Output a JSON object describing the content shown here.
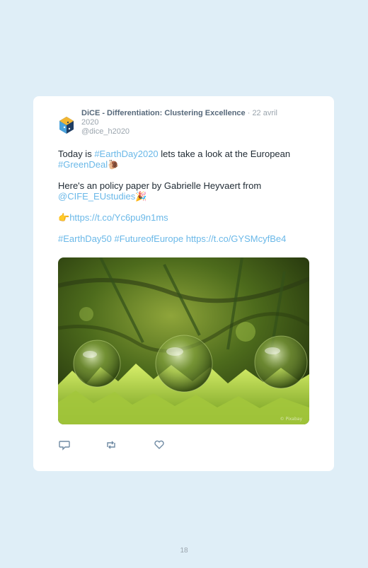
{
  "tweet": {
    "author_name": "DiCE - Differentiation: Clustering Excellence",
    "date": "· 22 avril 2020",
    "handle": "@dice_h2020",
    "line1_pre": "Today is ",
    "line1_tag": "#EarthDay2020",
    "line1_post": " lets take a look at the European ",
    "line1_tag2": "#GreenDeal",
    "line1_emoji": "🐌",
    "line2_pre": "Here's an policy paper by Gabrielle Heyvaert from ",
    "line2_mention": "@CIFE_EUstudies",
    "line2_emoji": "🎉",
    "line3_emoji": "👉",
    "line3_link": "https://t.co/Yc6pu9n1ms",
    "line4_tag1": "#EarthDay50",
    "line4_tag2": "#FutureofEurope",
    "line4_link": "https://t.co/GYSMcyfBe4",
    "image_watermark": "© Pixabay"
  },
  "actions": {
    "reply_icon": "reply-icon",
    "retweet_icon": "retweet-icon",
    "like_icon": "heart-icon"
  },
  "page_number": "18",
  "colors": {
    "background": "#dfeef7",
    "card": "#ffffff",
    "link": "#6ab8e8",
    "text": "#1f2a33",
    "muted": "#9aa4ad"
  }
}
